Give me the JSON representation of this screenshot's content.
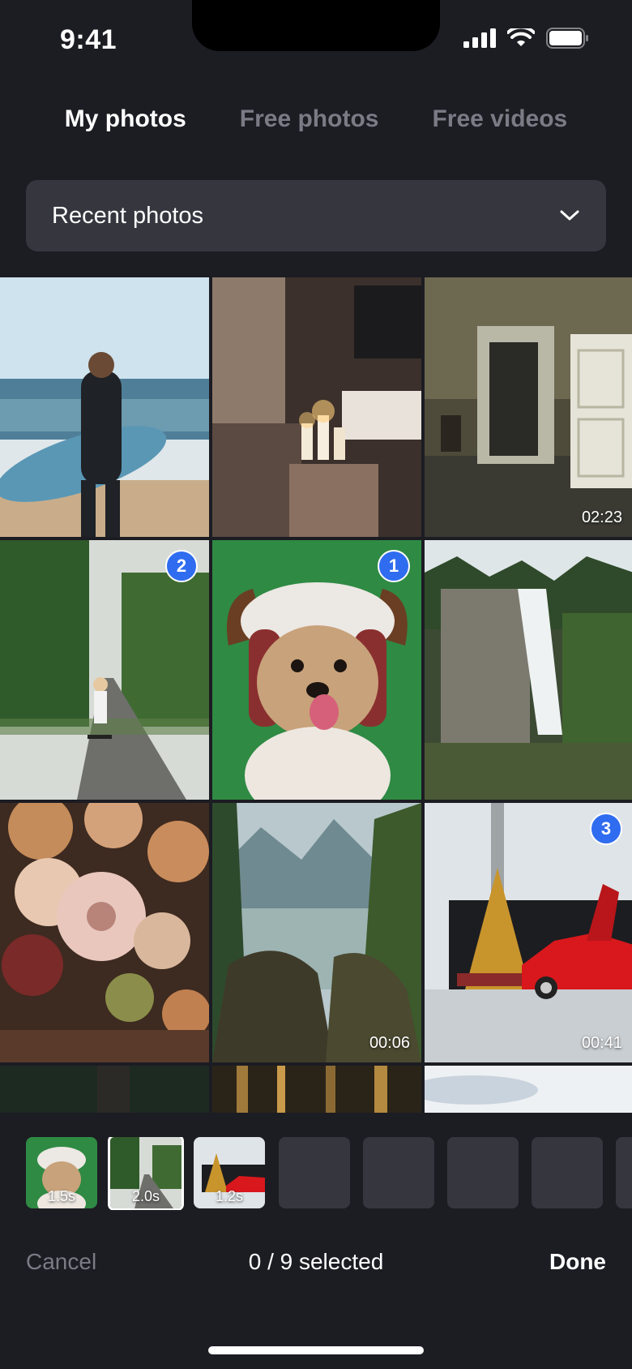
{
  "status_bar": {
    "time": "9:41"
  },
  "tabs": [
    {
      "label": "My photos",
      "active": true
    },
    {
      "label": "Free photos",
      "active": false
    },
    {
      "label": "Free videos",
      "active": false
    }
  ],
  "album_selector": {
    "label": "Recent photos"
  },
  "grid": {
    "items": [
      {
        "subject": "surfer",
        "selected_order": "",
        "duration": ""
      },
      {
        "subject": "candles-room",
        "selected_order": "",
        "duration": ""
      },
      {
        "subject": "interior-door",
        "selected_order": "",
        "duration": "02:23"
      },
      {
        "subject": "skateboarder",
        "selected_order": "2",
        "duration": ""
      },
      {
        "subject": "dog-antlers",
        "selected_order": "1",
        "duration": ""
      },
      {
        "subject": "waterfall",
        "selected_order": "",
        "duration": ""
      },
      {
        "subject": "flowers",
        "selected_order": "",
        "duration": ""
      },
      {
        "subject": "mountain-forest",
        "selected_order": "",
        "duration": "00:06"
      },
      {
        "subject": "car-christmas-tree",
        "selected_order": "3",
        "duration": "00:41"
      }
    ]
  },
  "tray": {
    "thumbs": [
      {
        "label": "1.5s"
      },
      {
        "label": "2.0s"
      },
      {
        "label": "1.2s"
      }
    ]
  },
  "footer": {
    "cancel_label": "Cancel",
    "selection_count": "0 / 9 selected",
    "done_label": "Done"
  },
  "colors": {
    "background": "#1c1c23",
    "accent": "#3a6de8",
    "inactive_text": "#7b7b86"
  }
}
